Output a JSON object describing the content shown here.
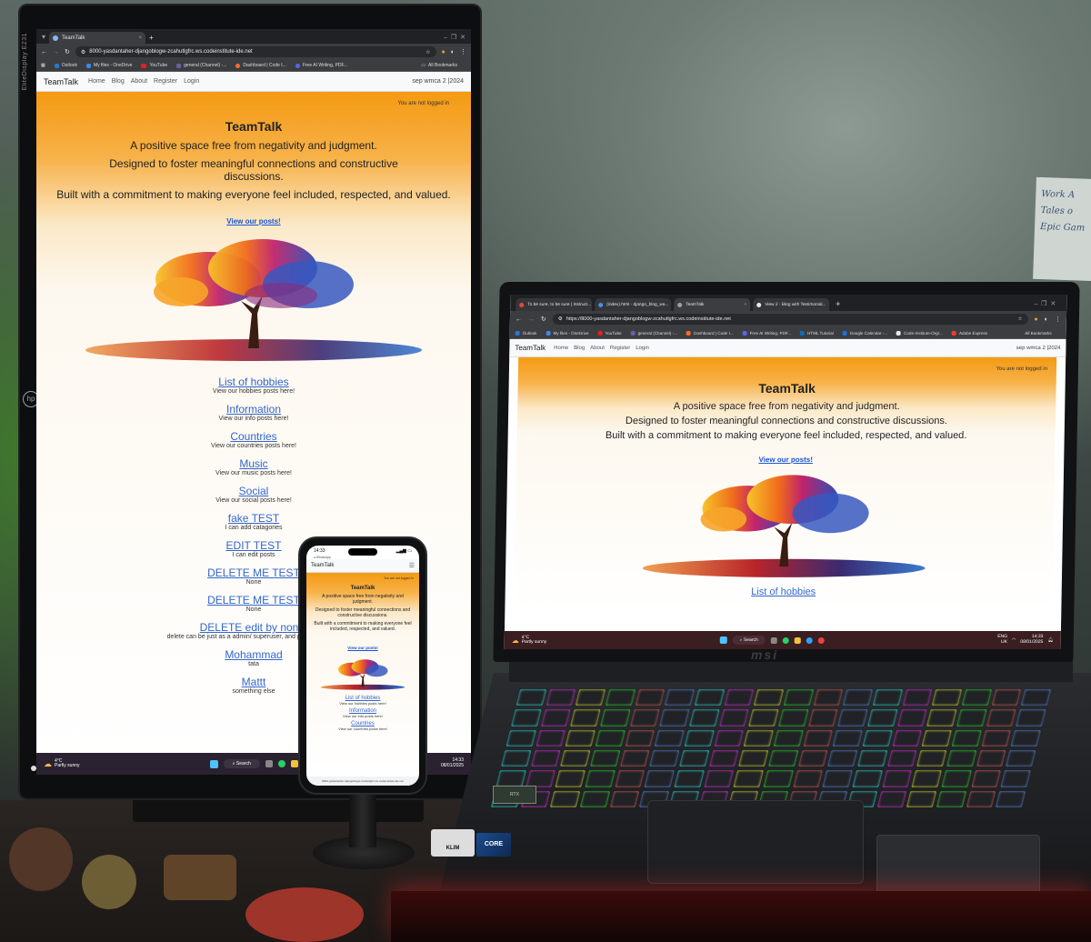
{
  "monitor": {
    "brand": "EliteDisplay E231",
    "browser": {
      "tab_title": "TeamTalk",
      "url": "8000-yasdantaher-djangoblogw-zcahutlgfrc.ws.codeinstitute-ide.net",
      "bookmarks": [
        "Outlook",
        "My files - OneDrive",
        "YouTube",
        "general (Channel) -...",
        "Dashboard | Code I...",
        "Free AI Writing, PDF..."
      ],
      "all_bookmarks": "All Bookmarks"
    },
    "site": {
      "brand": "TeamTalk",
      "nav": [
        "Home",
        "Blog",
        "About",
        "Register",
        "Login"
      ],
      "right_text": "sep wmca 2 |2024",
      "login_status": "You are not logged in",
      "title": "TeamTalk",
      "tagline1": "A positive space free from negativity and judgment.",
      "tagline2": "Designed to foster meaningful connections and constructive discussions.",
      "tagline3": "Built with a commitment to making everyone feel included, respected, and valued.",
      "cta": "View our posts!",
      "categories": [
        {
          "title": "List of hobbies",
          "desc": "View our hobbies posts here!"
        },
        {
          "title": "Information",
          "desc": "View our info posts here!"
        },
        {
          "title": "Countries",
          "desc": "View our countries posts here!"
        },
        {
          "title": "Music",
          "desc": "View our music posts here!"
        },
        {
          "title": "Social",
          "desc": "View our social posts here!"
        },
        {
          "title": "fake TEST",
          "desc": "I can add catagories"
        },
        {
          "title": "EDIT TEST",
          "desc": "I can edit posts"
        },
        {
          "title": "DELETE ME TEST",
          "desc": "None"
        },
        {
          "title": "DELETE ME TEST",
          "desc": "None"
        },
        {
          "title": "DELETE edit by non a",
          "desc": "delete can be just as a admin/ superuser, and prevent cascad"
        },
        {
          "title": "Mohammad",
          "desc": "tata"
        },
        {
          "title": "Mattt",
          "desc": "something else"
        }
      ]
    },
    "taskbar": {
      "temp": "4°C",
      "weather": "Partly sunny",
      "search": "Search",
      "time": "14:33",
      "date": "08/01/2025"
    }
  },
  "phone": {
    "time": "14:33",
    "subtitle": "◂ WhatsApp",
    "brand": "TeamTalk",
    "login_status": "You are not logged in",
    "title": "TeamTalk",
    "tagline1": "A positive space free from negativity and judgment.",
    "tagline2": "Designed to foster meaningful connections and constructive discussions.",
    "tagline3": "Built with a commitment to making everyone feel included, respected, and valued.",
    "cta": "View our posts!",
    "categories": [
      {
        "title": "List of hobbies",
        "desc": "View our hobbies posts here!"
      },
      {
        "title": "Information",
        "desc": "View our info posts here!"
      },
      {
        "title": "Countries",
        "desc": "View our countries posts here!"
      }
    ],
    "url": "8000-yasdantaher-djangoblogw-zcahutlgfrc.ws.codeinstitute-ide.net"
  },
  "laptop": {
    "brand": "msi",
    "browser": {
      "tabs": [
        "To be sure, to be sure | Instruct...",
        "(index).html - django_blog_wa...",
        "TeamTalk",
        "View 2 - Blog with Testimonial..."
      ],
      "url": "https://8000-yasdantaher-djangoblogw-zcahutlgfrc.ws.codeinstitute-ide.net",
      "bookmarks": [
        "Outlook",
        "My files - OneDrive",
        "YouTube",
        "general (Channel) -...",
        "Dashboard | Code I...",
        "Free AI Writing, PDF...",
        "HTML Tutorial",
        "Google Calendar -...",
        "Code-Institute-Org/...",
        "Adobe Express"
      ],
      "all_bookmarks": "All Bookmarks"
    },
    "site": {
      "brand": "TeamTalk",
      "nav": [
        "Home",
        "Blog",
        "About",
        "Register",
        "Login"
      ],
      "right_text": "sep wmca 2 |2024",
      "login_status": "You are not logged in",
      "title": "TeamTalk",
      "tagline1": "A positive space free from negativity and judgment.",
      "tagline2": "Designed to foster meaningful connections and constructive discussions.",
      "tagline3": "Built with a commitment to making everyone feel included, respected, and valued.",
      "cta": "View our posts!",
      "first_category": "List of hobbies"
    },
    "taskbar": {
      "temp": "4°C",
      "weather": "Partly sunny",
      "search": "Search",
      "lang": "ENG",
      "region": "UK",
      "time": "14:33",
      "date": "08/01/2025"
    },
    "stickers": {
      "cpu": "CORE",
      "cooler": "KLIM",
      "gpu": "RTX"
    }
  },
  "note": {
    "lines": [
      "Work A",
      "Tales o",
      "Epic Gam"
    ]
  },
  "colors": {
    "accent_orange": "#f49a12",
    "link_blue": "#3366cc",
    "taskbar": "#2a2230",
    "chrome": "#202124"
  }
}
